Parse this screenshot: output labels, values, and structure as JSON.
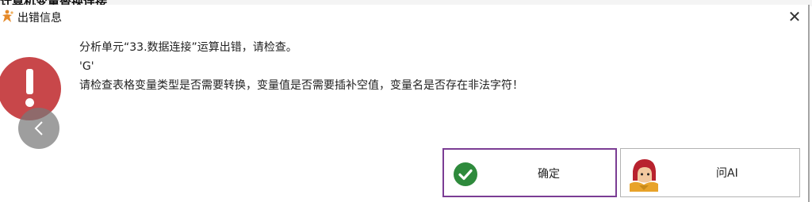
{
  "background": {
    "partial_text": "计算机变量替换连接"
  },
  "dialog": {
    "title": "出错信息",
    "close_glyph": "✕",
    "messages": [
      "分析单元“33.数据连接”运算出错，请检查。",
      "'G'",
      "请检查表格变量类型是否需要转换，变量值是否需要插补空值，变量名是否存在非法字符！"
    ],
    "buttons": {
      "ok": "确定",
      "ask_ai": "问AI"
    }
  },
  "icons": {
    "app": "app-logo-icon",
    "error": "error-exclamation-icon",
    "nav_prev": "chevron-left-icon",
    "ok": "check-circle-icon",
    "ai": "ai-avatar-icon"
  },
  "colors": {
    "error_red": "#c8474a",
    "ok_green": "#2e8a3c",
    "focus_border": "#7b3d94"
  }
}
